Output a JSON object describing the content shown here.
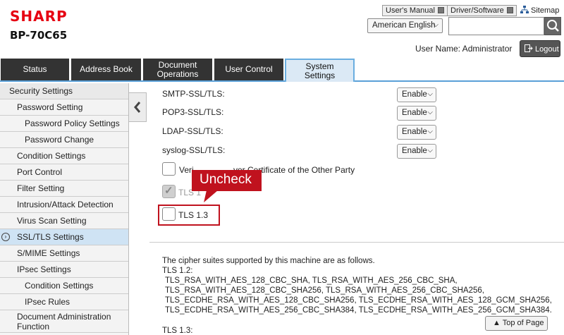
{
  "header": {
    "logo": "SHARP",
    "model": "BP-70C65",
    "users_manual": "User's Manual",
    "driver_software": "Driver/Software",
    "sitemap": "Sitemap",
    "language": "American English",
    "search_placeholder": "",
    "user_name": "User Name: Administrator",
    "logout": "Logout"
  },
  "tabs": [
    "Status",
    "Address Book",
    "Document Operations",
    "User Control",
    "System Settings"
  ],
  "active_tab": "System Settings",
  "sidebar": {
    "items": [
      {
        "label": "Security Settings",
        "level": 0
      },
      {
        "label": "Password Setting",
        "level": 1
      },
      {
        "label": "Password Policy Settings",
        "level": 2
      },
      {
        "label": "Password Change",
        "level": 2
      },
      {
        "label": "Condition Settings",
        "level": 1
      },
      {
        "label": "Port Control",
        "level": 1
      },
      {
        "label": "Filter Setting",
        "level": 1
      },
      {
        "label": "Intrusion/Attack Detection",
        "level": 1
      },
      {
        "label": "Virus Scan Setting",
        "level": 1
      },
      {
        "label": "SSL/TLS Settings",
        "level": 1,
        "active": true
      },
      {
        "label": "S/MIME Settings",
        "level": 1
      },
      {
        "label": "IPsec Settings",
        "level": 1
      },
      {
        "label": "Condition Settings",
        "level": 2
      },
      {
        "label": "IPsec Rules",
        "level": 2
      },
      {
        "label": "Document Administration Function",
        "level": 1
      }
    ]
  },
  "settings": {
    "smtp": {
      "label": "SMTP-SSL/TLS:",
      "value": "Enable"
    },
    "pop3": {
      "label": "POP3-SSL/TLS:",
      "value": "Enable"
    },
    "ldap": {
      "label": "LDAP-SSL/TLS:",
      "value": "Enable"
    },
    "syslog": {
      "label": "syslog-SSL/TLS:",
      "value": "Enable"
    },
    "verify_label_a": "Veri",
    "verify_label_b": "ver Certificate of the Other Party",
    "tls12_label": "TLS 1",
    "tls13_label": "TLS 1.3",
    "tls12_checked": true,
    "tls13_checked": false
  },
  "callout": "Uncheck",
  "cipher": {
    "intro": "The cipher suites supported by this machine are as follows.",
    "tls12_heading": "TLS 1.2:",
    "tls12_lines": [
      "TLS_RSA_WITH_AES_128_CBC_SHA, TLS_RSA_WITH_AES_256_CBC_SHA,",
      "TLS_RSA_WITH_AES_128_CBC_SHA256, TLS_RSA_WITH_AES_256_CBC_SHA256,",
      "TLS_ECDHE_RSA_WITH_AES_128_CBC_SHA256, TLS_ECDHE_RSA_WITH_AES_128_GCM_SHA256,",
      "TLS_ECDHE_RSA_WITH_AES_256_CBC_SHA384, TLS_ECDHE_RSA_WITH_AES_256_GCM_SHA384."
    ],
    "tls13_heading": "TLS 1.3:"
  },
  "top_of_page": "Top of Page",
  "colors": {
    "brand": "#e60012",
    "callout": "#c0121e",
    "tab_dark": "#333333",
    "active_bg": "#cfe3f4"
  }
}
